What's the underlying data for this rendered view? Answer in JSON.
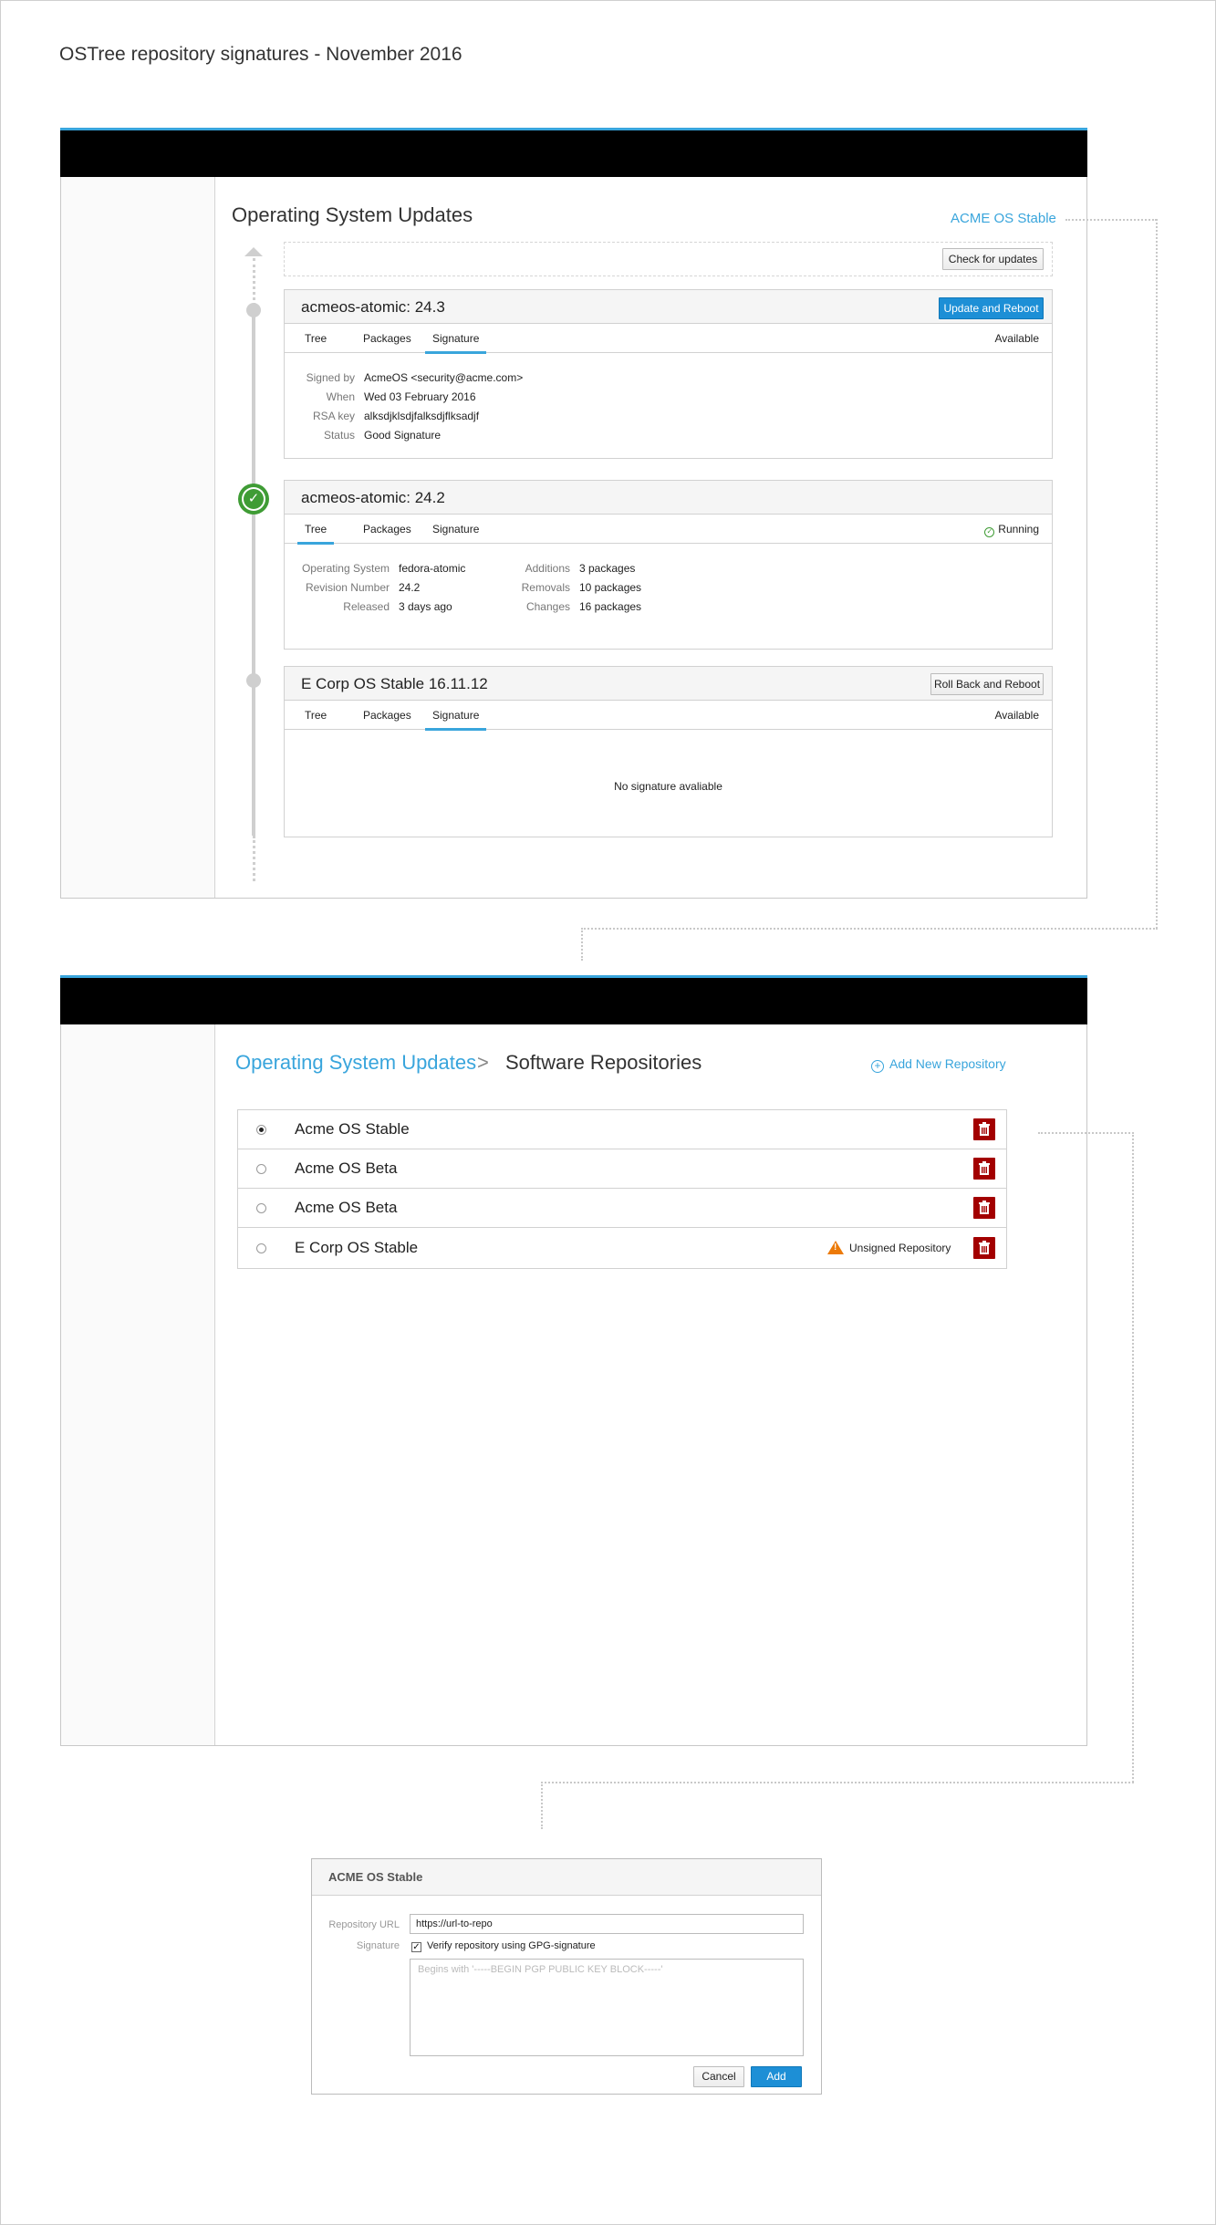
{
  "page": {
    "title": "OSTree repository signatures - November 2016"
  },
  "win1": {
    "title": "Operating System Updates",
    "origin_link": "ACME OS Stable",
    "check_button": "Check for updates",
    "cards": [
      {
        "title": "acmeos-atomic: 24.3",
        "action": "Update and Reboot",
        "tabs": [
          "Tree",
          "Packages",
          "Signature"
        ],
        "active_tab": "Signature",
        "status": "Available",
        "fields": [
          {
            "label": "Signed by",
            "value": "AcmeOS <security@acme.com>"
          },
          {
            "label": "When",
            "value": "Wed 03 February 2016"
          },
          {
            "label": "RSA key",
            "value": "alksdjklsdjfalksdjflksadjf"
          },
          {
            "label": "Status",
            "value": "Good Signature"
          }
        ]
      },
      {
        "title": "acmeos-atomic: 24.2",
        "tabs": [
          "Tree",
          "Packages",
          "Signature"
        ],
        "active_tab": "Tree",
        "status": "Running",
        "left_fields": [
          {
            "label": "Operating System",
            "value": "fedora-atomic"
          },
          {
            "label": "Revision Number",
            "value": "24.2"
          },
          {
            "label": "Released",
            "value": "3 days ago"
          }
        ],
        "right_fields": [
          {
            "label": "Additions",
            "value": "3 packages"
          },
          {
            "label": "Removals",
            "value": "10 packages"
          },
          {
            "label": "Changes",
            "value": "16 packages"
          }
        ]
      },
      {
        "title": "E Corp OS Stable 16.11.12",
        "action": "Roll Back and Reboot",
        "tabs": [
          "Tree",
          "Packages",
          "Signature"
        ],
        "active_tab": "Signature",
        "status": "Available",
        "empty": "No signature avaliable"
      }
    ]
  },
  "win2": {
    "breadcrumb": {
      "parent": "Operating System Updates",
      "separator": ">",
      "current": "Software Repositories"
    },
    "add_link": "Add New Repository",
    "repos": [
      {
        "name": "Acme OS Stable",
        "selected": true
      },
      {
        "name": "Acme OS Beta",
        "selected": false
      },
      {
        "name": "Acme OS Beta",
        "selected": false
      },
      {
        "name": "E Corp OS Stable",
        "selected": false,
        "warning": "Unsigned Repository"
      }
    ]
  },
  "dialog": {
    "title": "ACME OS Stable",
    "url_label": "Repository URL",
    "url_value": "https://url-to-repo",
    "signature_label": "Signature",
    "verify_label": "Verify repository using GPG-signature",
    "verify_checked": true,
    "key_placeholder": "Begins with '-----BEGIN PGP PUBLIC KEY BLOCK-----'",
    "cancel": "Cancel",
    "add": "Add"
  },
  "colors": {
    "accent": "#39a5dc",
    "primary_button": "#1d8fd6",
    "danger": "#a30000",
    "success": "#3f9c35",
    "warning": "#ec7a08"
  }
}
